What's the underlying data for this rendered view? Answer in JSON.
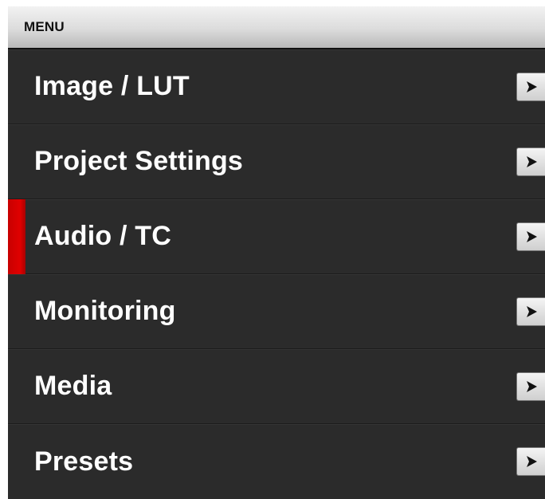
{
  "header": {
    "title": "MENU"
  },
  "colors": {
    "selected_indicator": "#d40000",
    "item_background": "#2b2b2b",
    "item_text": "#ffffff"
  },
  "menu": {
    "items": [
      {
        "label": "Image / LUT",
        "icon": "chevron-right-icon",
        "selected": false
      },
      {
        "label": "Project Settings",
        "icon": "chevron-right-icon",
        "selected": false
      },
      {
        "label": "Audio / TC",
        "icon": "chevron-right-icon",
        "selected": true
      },
      {
        "label": "Monitoring",
        "icon": "chevron-right-icon",
        "selected": false
      },
      {
        "label": "Media",
        "icon": "chevron-right-icon",
        "selected": false
      },
      {
        "label": "Presets",
        "icon": "chevron-right-icon",
        "selected": false
      }
    ]
  }
}
